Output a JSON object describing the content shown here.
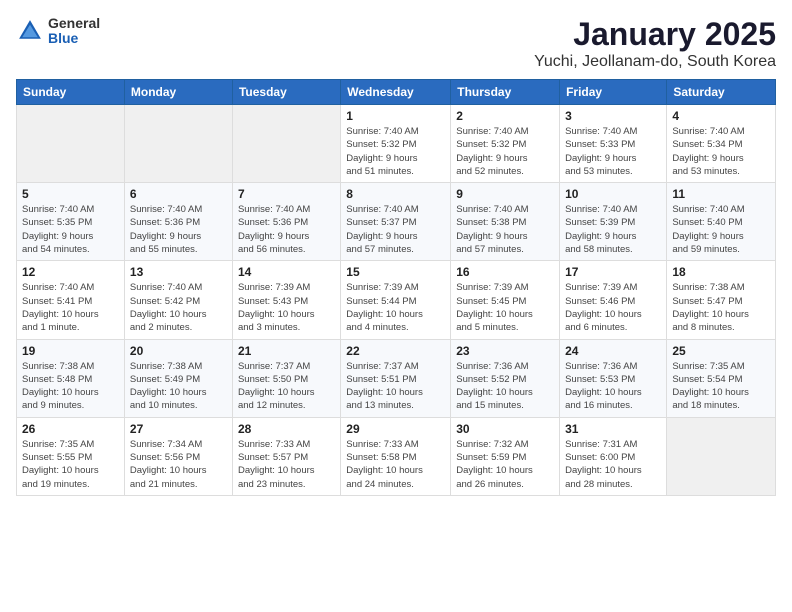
{
  "header": {
    "logo_general": "General",
    "logo_blue": "Blue",
    "title": "January 2025",
    "subtitle": "Yuchi, Jeollanam-do, South Korea"
  },
  "days_of_week": [
    "Sunday",
    "Monday",
    "Tuesday",
    "Wednesday",
    "Thursday",
    "Friday",
    "Saturday"
  ],
  "weeks": [
    [
      {
        "day": "",
        "detail": ""
      },
      {
        "day": "",
        "detail": ""
      },
      {
        "day": "",
        "detail": ""
      },
      {
        "day": "1",
        "detail": "Sunrise: 7:40 AM\nSunset: 5:32 PM\nDaylight: 9 hours\nand 51 minutes."
      },
      {
        "day": "2",
        "detail": "Sunrise: 7:40 AM\nSunset: 5:32 PM\nDaylight: 9 hours\nand 52 minutes."
      },
      {
        "day": "3",
        "detail": "Sunrise: 7:40 AM\nSunset: 5:33 PM\nDaylight: 9 hours\nand 53 minutes."
      },
      {
        "day": "4",
        "detail": "Sunrise: 7:40 AM\nSunset: 5:34 PM\nDaylight: 9 hours\nand 53 minutes."
      }
    ],
    [
      {
        "day": "5",
        "detail": "Sunrise: 7:40 AM\nSunset: 5:35 PM\nDaylight: 9 hours\nand 54 minutes."
      },
      {
        "day": "6",
        "detail": "Sunrise: 7:40 AM\nSunset: 5:36 PM\nDaylight: 9 hours\nand 55 minutes."
      },
      {
        "day": "7",
        "detail": "Sunrise: 7:40 AM\nSunset: 5:36 PM\nDaylight: 9 hours\nand 56 minutes."
      },
      {
        "day": "8",
        "detail": "Sunrise: 7:40 AM\nSunset: 5:37 PM\nDaylight: 9 hours\nand 57 minutes."
      },
      {
        "day": "9",
        "detail": "Sunrise: 7:40 AM\nSunset: 5:38 PM\nDaylight: 9 hours\nand 57 minutes."
      },
      {
        "day": "10",
        "detail": "Sunrise: 7:40 AM\nSunset: 5:39 PM\nDaylight: 9 hours\nand 58 minutes."
      },
      {
        "day": "11",
        "detail": "Sunrise: 7:40 AM\nSunset: 5:40 PM\nDaylight: 9 hours\nand 59 minutes."
      }
    ],
    [
      {
        "day": "12",
        "detail": "Sunrise: 7:40 AM\nSunset: 5:41 PM\nDaylight: 10 hours\nand 1 minute."
      },
      {
        "day": "13",
        "detail": "Sunrise: 7:40 AM\nSunset: 5:42 PM\nDaylight: 10 hours\nand 2 minutes."
      },
      {
        "day": "14",
        "detail": "Sunrise: 7:39 AM\nSunset: 5:43 PM\nDaylight: 10 hours\nand 3 minutes."
      },
      {
        "day": "15",
        "detail": "Sunrise: 7:39 AM\nSunset: 5:44 PM\nDaylight: 10 hours\nand 4 minutes."
      },
      {
        "day": "16",
        "detail": "Sunrise: 7:39 AM\nSunset: 5:45 PM\nDaylight: 10 hours\nand 5 minutes."
      },
      {
        "day": "17",
        "detail": "Sunrise: 7:39 AM\nSunset: 5:46 PM\nDaylight: 10 hours\nand 6 minutes."
      },
      {
        "day": "18",
        "detail": "Sunrise: 7:38 AM\nSunset: 5:47 PM\nDaylight: 10 hours\nand 8 minutes."
      }
    ],
    [
      {
        "day": "19",
        "detail": "Sunrise: 7:38 AM\nSunset: 5:48 PM\nDaylight: 10 hours\nand 9 minutes."
      },
      {
        "day": "20",
        "detail": "Sunrise: 7:38 AM\nSunset: 5:49 PM\nDaylight: 10 hours\nand 10 minutes."
      },
      {
        "day": "21",
        "detail": "Sunrise: 7:37 AM\nSunset: 5:50 PM\nDaylight: 10 hours\nand 12 minutes."
      },
      {
        "day": "22",
        "detail": "Sunrise: 7:37 AM\nSunset: 5:51 PM\nDaylight: 10 hours\nand 13 minutes."
      },
      {
        "day": "23",
        "detail": "Sunrise: 7:36 AM\nSunset: 5:52 PM\nDaylight: 10 hours\nand 15 minutes."
      },
      {
        "day": "24",
        "detail": "Sunrise: 7:36 AM\nSunset: 5:53 PM\nDaylight: 10 hours\nand 16 minutes."
      },
      {
        "day": "25",
        "detail": "Sunrise: 7:35 AM\nSunset: 5:54 PM\nDaylight: 10 hours\nand 18 minutes."
      }
    ],
    [
      {
        "day": "26",
        "detail": "Sunrise: 7:35 AM\nSunset: 5:55 PM\nDaylight: 10 hours\nand 19 minutes."
      },
      {
        "day": "27",
        "detail": "Sunrise: 7:34 AM\nSunset: 5:56 PM\nDaylight: 10 hours\nand 21 minutes."
      },
      {
        "day": "28",
        "detail": "Sunrise: 7:33 AM\nSunset: 5:57 PM\nDaylight: 10 hours\nand 23 minutes."
      },
      {
        "day": "29",
        "detail": "Sunrise: 7:33 AM\nSunset: 5:58 PM\nDaylight: 10 hours\nand 24 minutes."
      },
      {
        "day": "30",
        "detail": "Sunrise: 7:32 AM\nSunset: 5:59 PM\nDaylight: 10 hours\nand 26 minutes."
      },
      {
        "day": "31",
        "detail": "Sunrise: 7:31 AM\nSunset: 6:00 PM\nDaylight: 10 hours\nand 28 minutes."
      },
      {
        "day": "",
        "detail": ""
      }
    ]
  ]
}
